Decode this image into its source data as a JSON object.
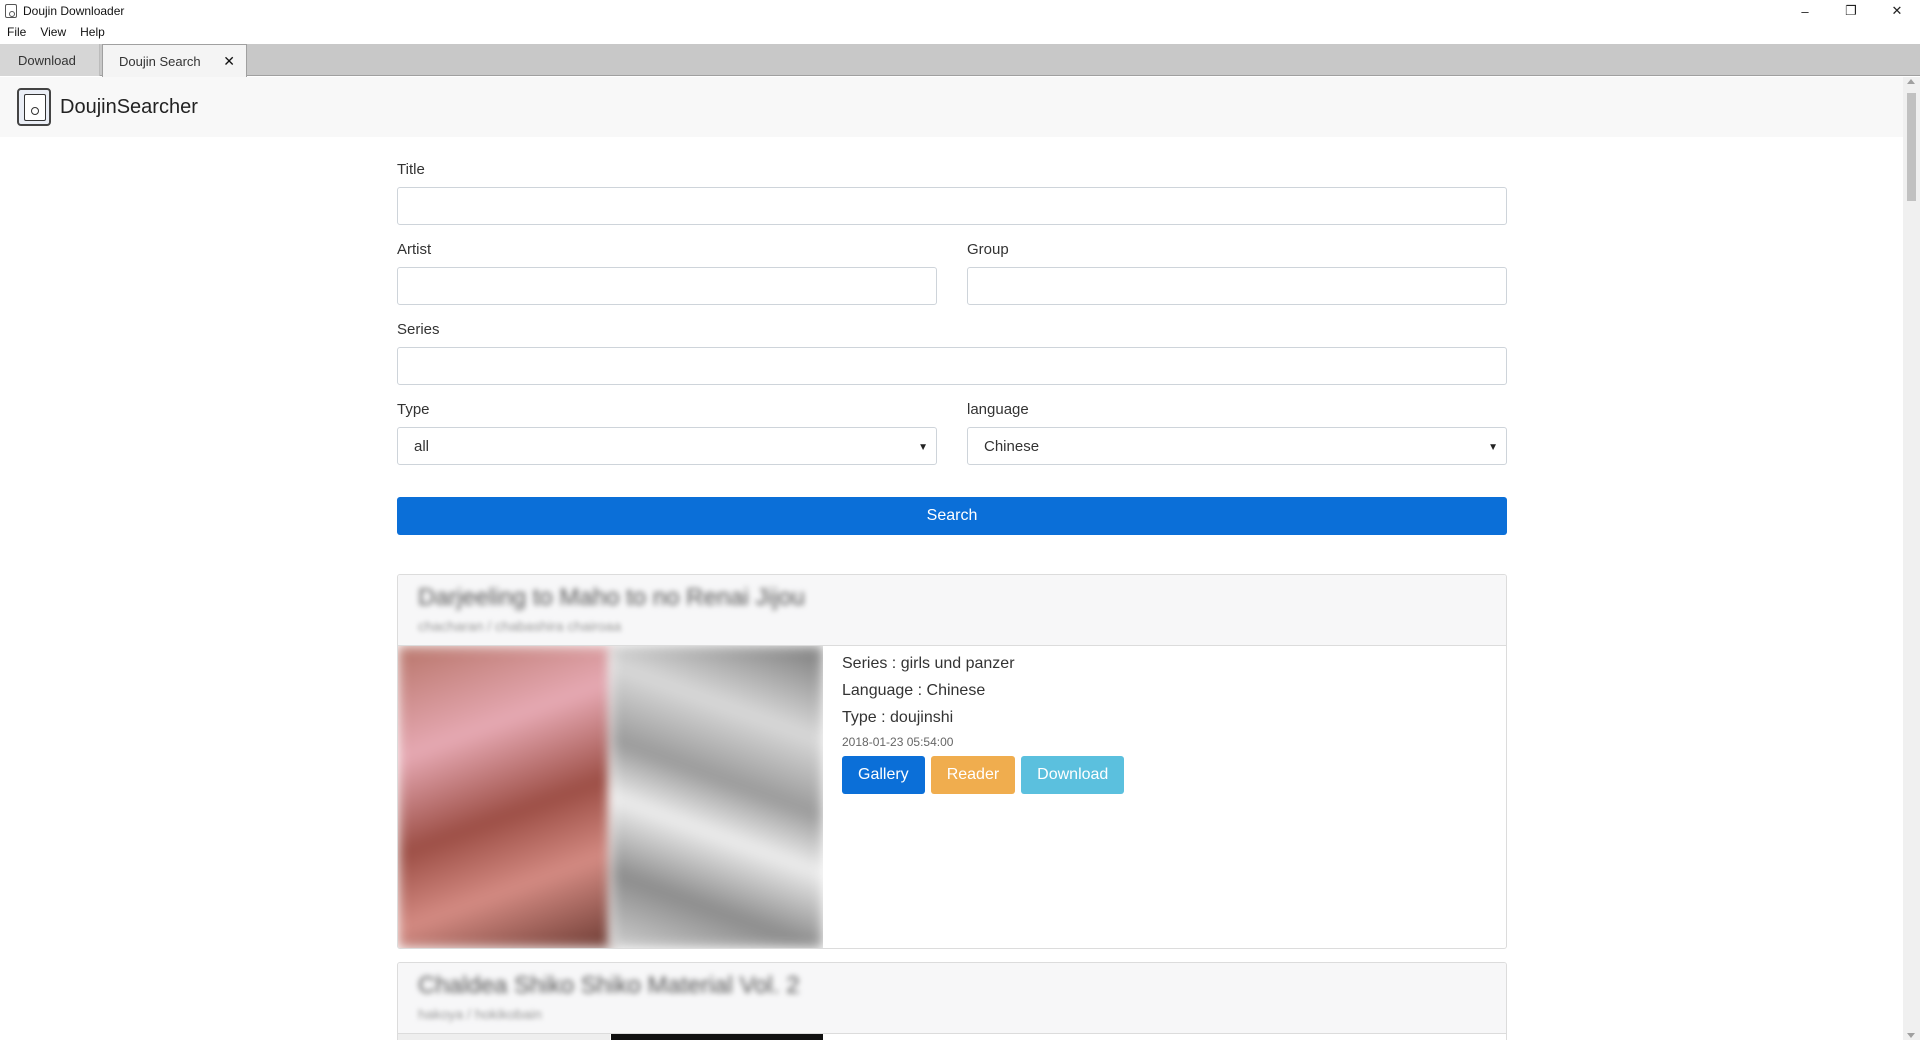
{
  "window": {
    "title": "Doujin Downloader",
    "minimize": "–",
    "maximize": "❐",
    "close": "✕"
  },
  "menu": [
    "File",
    "View",
    "Help"
  ],
  "tabs": [
    {
      "label": "Download"
    },
    {
      "label": "Doujin Search",
      "close": "✕"
    }
  ],
  "header": {
    "brand": "DoujinSearcher"
  },
  "form": {
    "title_label": "Title",
    "artist_label": "Artist",
    "group_label": "Group",
    "series_label": "Series",
    "type_label": "Type",
    "type_value": "all",
    "language_label": "language",
    "language_value": "Chinese",
    "search_label": "Search"
  },
  "results": [
    {
      "title": "Darjeeling to Maho to no Renai Jijou",
      "subtitle": "chacharan / chabashira chairoaa",
      "series": "Series : girls und panzer",
      "language": "Language : Chinese",
      "type": "Type : doujinshi",
      "date": "2018-01-23 05:54:00",
      "gallery_label": "Gallery",
      "reader_label": "Reader",
      "download_label": "Download"
    },
    {
      "title": "Chaldea Shiko Shiko Material Vol. 2",
      "subtitle": "hakoya / hokikobain"
    }
  ],
  "colors": {
    "primary": "#0b6fd8",
    "reader": "#f0ad4e",
    "download": "#5bc0de"
  }
}
